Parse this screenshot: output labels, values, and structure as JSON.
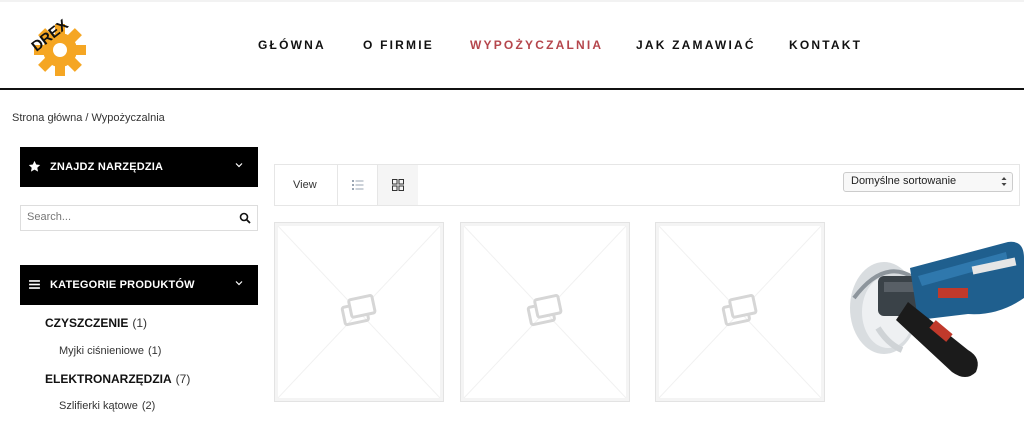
{
  "header": {
    "logo_text": "DREX",
    "nav": [
      {
        "label": "GŁÓWNA",
        "active": false
      },
      {
        "label": "O FIRMIE",
        "active": false
      },
      {
        "label": "WYPOŻYCZALNIA",
        "active": true
      },
      {
        "label": "JAK ZAMAWIAĆ",
        "active": false
      },
      {
        "label": "KONTAKT",
        "active": false
      }
    ]
  },
  "breadcrumb": "Strona główna / Wypożyczalnia",
  "sidebar": {
    "tools_widget": {
      "title": "ZNAJDZ NARZĘDZIA",
      "icon": "star-icon"
    },
    "search": {
      "placeholder": "Search..."
    },
    "categories_widget": {
      "title": "KATEGORIE PRODUKTÓW",
      "icon": "menu-icon"
    },
    "categories": [
      {
        "name": "CZYSZCZENIE",
        "count": "(1)",
        "level": "main"
      },
      {
        "name": "Myjki ciśnieniowe",
        "count": "(1)",
        "level": "sub"
      },
      {
        "name": "ELEKTRONARZĘDZIA",
        "count": "(7)",
        "level": "main"
      },
      {
        "name": "Szlifierki kątowe",
        "count": "(2)",
        "level": "sub"
      }
    ]
  },
  "toolbar": {
    "view_label": "View",
    "view_modes": [
      "list-icon",
      "grid-icon"
    ],
    "active_view": "grid",
    "sort_value": "Domyślne sortowanie"
  },
  "products": [
    {
      "image": "placeholder-image-icon"
    },
    {
      "image": "placeholder-image-icon"
    },
    {
      "image": "placeholder-image-icon"
    },
    {
      "image": "angle-grinder-photo"
    }
  ],
  "colors": {
    "active_nav": "#b5464c",
    "widget_bg": "#000000",
    "logo_gear": "#f5a623"
  }
}
